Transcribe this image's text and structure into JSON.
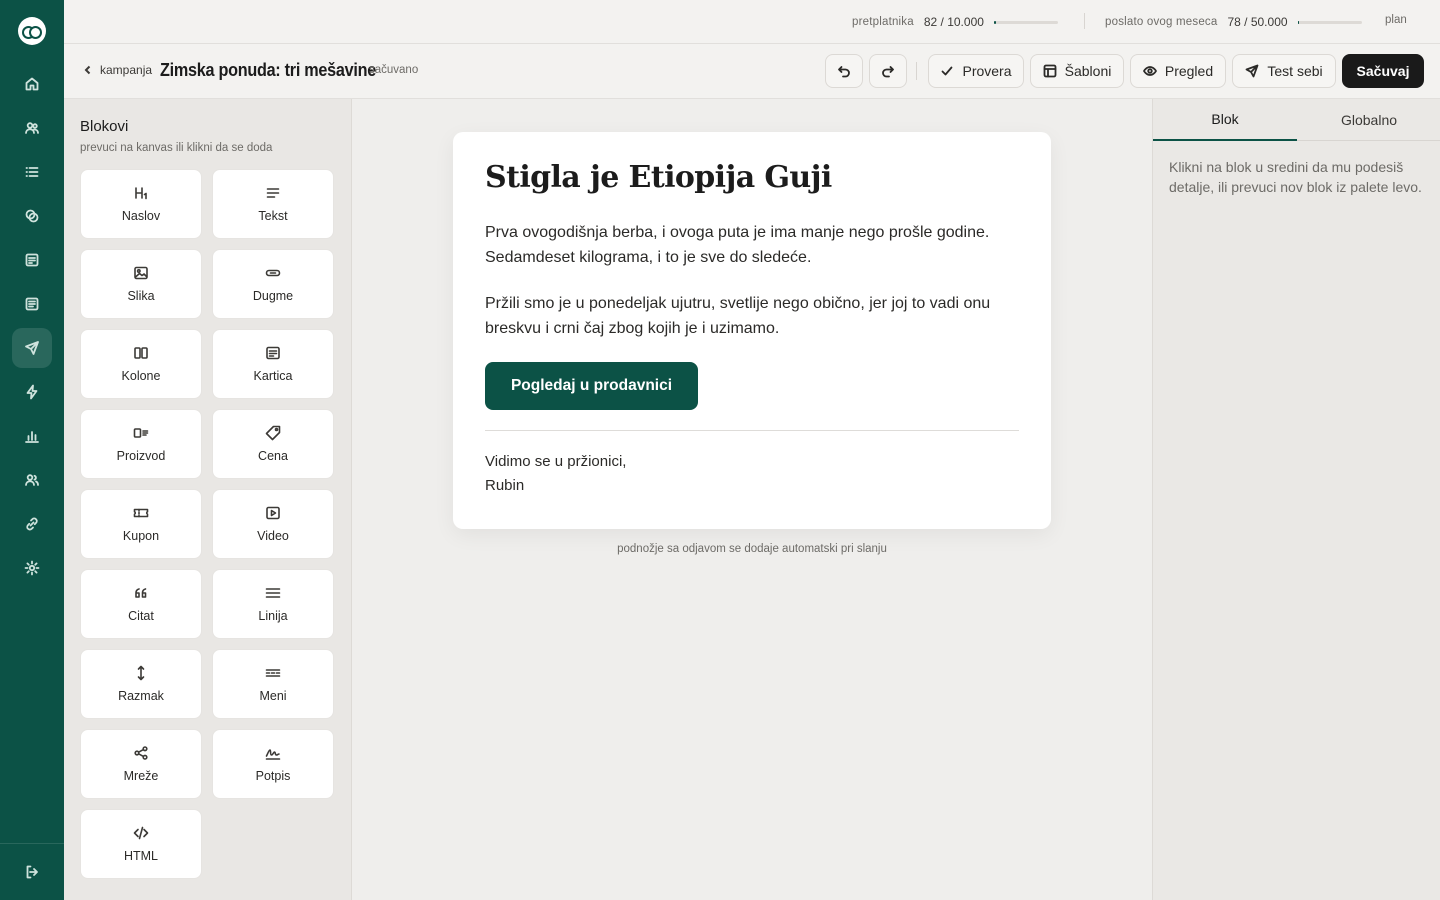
{
  "rail": {
    "items": [
      {
        "icon": "home-icon"
      },
      {
        "icon": "users-icon"
      },
      {
        "icon": "list-icon"
      },
      {
        "icon": "segments-icon"
      },
      {
        "icon": "forms-icon"
      },
      {
        "icon": "pages-icon"
      },
      {
        "icon": "send-icon",
        "active": true
      },
      {
        "icon": "automation-icon"
      },
      {
        "icon": "reports-icon"
      },
      {
        "icon": "team-icon"
      },
      {
        "icon": "integrations-icon"
      },
      {
        "icon": "settings-icon"
      }
    ],
    "logout_icon": "logout-icon"
  },
  "usage": {
    "subscribers": {
      "label": "pretplatnika",
      "value": "82 / 10.000",
      "fraction": 0.0082
    },
    "sent": {
      "label": "poslato ovog meseca",
      "value": "78 / 50.000",
      "fraction": 0.0016
    },
    "plan_label": "plan"
  },
  "header": {
    "back_label": "kampanja",
    "title": "Zimska ponuda: tri mešavine",
    "status": "sačuvano",
    "undo_icon": "undo-icon",
    "redo_icon": "redo-icon",
    "check_label": "Provera",
    "templates_label": "Šabloni",
    "preview_label": "Pregled",
    "test_label": "Test sebi",
    "save_label": "Sačuvaj"
  },
  "palette": {
    "title": "Blokovi",
    "hint": "prevuci na kanvas ili klikni da se doda",
    "blocks": [
      {
        "label": "Naslov",
        "icon": "heading-icon"
      },
      {
        "label": "Tekst",
        "icon": "text-icon"
      },
      {
        "label": "Slika",
        "icon": "image-icon"
      },
      {
        "label": "Dugme",
        "icon": "button-icon"
      },
      {
        "label": "Kolone",
        "icon": "columns-icon"
      },
      {
        "label": "Kartica",
        "icon": "card-icon"
      },
      {
        "label": "Proizvod",
        "icon": "product-icon"
      },
      {
        "label": "Cena",
        "icon": "price-tag-icon"
      },
      {
        "label": "Kupon",
        "icon": "coupon-icon"
      },
      {
        "label": "Video",
        "icon": "video-icon"
      },
      {
        "label": "Citat",
        "icon": "quote-icon"
      },
      {
        "label": "Linija",
        "icon": "divider-icon"
      },
      {
        "label": "Razmak",
        "icon": "spacer-icon"
      },
      {
        "label": "Meni",
        "icon": "menu-icon"
      },
      {
        "label": "Mreže",
        "icon": "share-icon"
      },
      {
        "label": "Potpis",
        "icon": "signature-icon"
      },
      {
        "label": "HTML",
        "icon": "code-icon"
      }
    ]
  },
  "email": {
    "heading": "Stigla je Etiopija Guji",
    "paragraph1": "Prva ovogodišnja berba, i ovoga puta je ima manje nego prošle godine. Sedamdeset kilograma, i to je sve do sledeće.",
    "paragraph2": "Pržili smo je u ponedeljak ujutru, svetlije nego obično, jer joj to vadi onu breskvu i crni čaj zbog kojih je i uzimamo.",
    "cta_label": "Pogledaj u prodavnici",
    "sign_line1": "Vidimo se u pržionici,",
    "sign_line2": "Rubin",
    "footnote": "podnožje sa odjavom se dodaje automatski pri slanju"
  },
  "inspector": {
    "tabs": [
      {
        "label": "Blok",
        "active": true
      },
      {
        "label": "Globalno",
        "active": false
      }
    ],
    "info": "Klikni na blok u sredini da mu podesiš detalje, ili prevuci nov blok iz palete levo."
  },
  "colors": {
    "brand": "#0c5246",
    "primary_button": "#1a1a1a",
    "canvas_bg": "#efeeec"
  }
}
